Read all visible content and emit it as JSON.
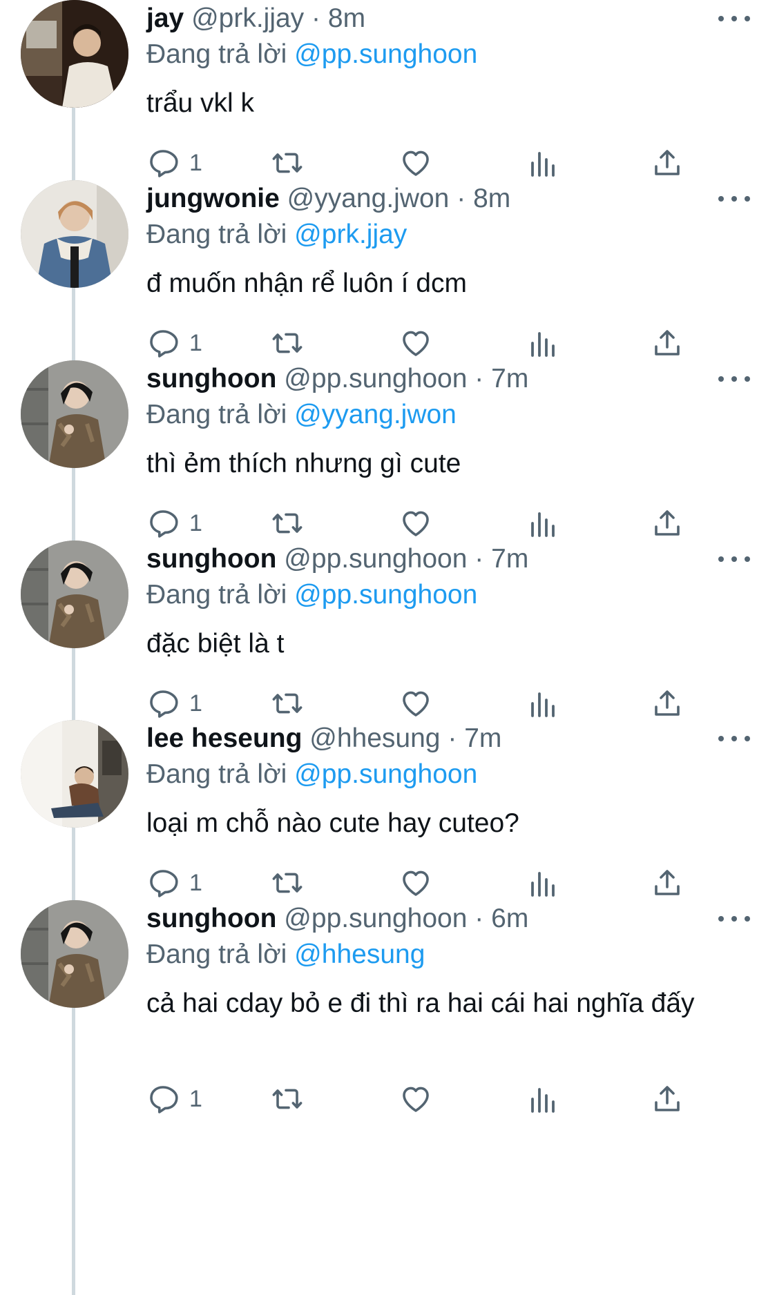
{
  "tweets": [
    {
      "name": "jay",
      "handle": "@prk.jjay",
      "time": "8m",
      "replying_label": "Đang trả lời",
      "replying_to": "@pp.sunghoon",
      "text": "trẩu vkl k",
      "reply_count": "1"
    },
    {
      "name": "jungwonie",
      "handle": "@yyang.jwon",
      "time": "8m",
      "replying_label": "Đang trả lời",
      "replying_to": "@prk.jjay",
      "text": "đ muốn nhận rể luôn í dcm",
      "reply_count": "1"
    },
    {
      "name": "sunghoon",
      "handle": "@pp.sunghoon",
      "time": "7m",
      "replying_label": "Đang trả lời",
      "replying_to": "@yyang.jwon",
      "text": "thì ẻm thích nhưng gì cute",
      "reply_count": "1"
    },
    {
      "name": "sunghoon",
      "handle": "@pp.sunghoon",
      "time": "7m",
      "replying_label": "Đang trả lời",
      "replying_to": "@pp.sunghoon",
      "text": "đặc biệt là t",
      "reply_count": "1"
    },
    {
      "name": "lee heseung",
      "handle": "@hhesung",
      "time": "7m",
      "replying_label": "Đang trả lời",
      "replying_to": "@pp.sunghoon",
      "text": "loại m chỗ nào cute hay cuteo?",
      "reply_count": "1"
    },
    {
      "name": "sunghoon",
      "handle": "@pp.sunghoon",
      "time": "6m",
      "replying_label": "Đang trả lời",
      "replying_to": "@hhesung",
      "text": "cả hai cday bỏ e đi thì ra hai cái hai nghĩa đấy",
      "reply_count": "1"
    }
  ],
  "colors": {
    "text": "#0f1419",
    "secondary": "#536471",
    "link": "#1d9bf0",
    "thread_line": "#cfd9de"
  },
  "icons": [
    "reply-icon",
    "retweet-icon",
    "like-icon",
    "views-icon",
    "share-icon",
    "more-icon"
  ]
}
